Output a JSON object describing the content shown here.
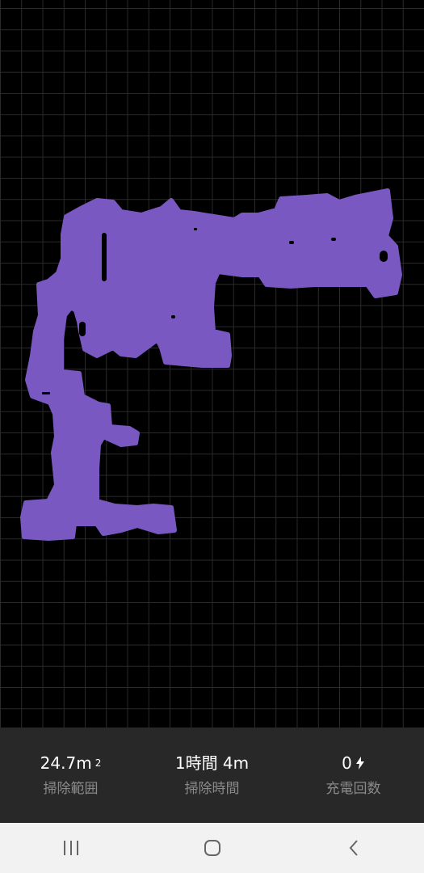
{
  "stats": {
    "area": {
      "value": "24.7m",
      "unit_sup": "2",
      "label": "掃除範囲"
    },
    "time": {
      "value": "1時間 4m",
      "label": "掃除時間"
    },
    "charge": {
      "value": "0",
      "label": "充電回数",
      "icon": "lightning-bolt-icon"
    }
  },
  "navigation": {
    "recent": "recent-apps-icon",
    "home": "home-icon",
    "back": "back-icon"
  },
  "colors": {
    "cleaned_area": "#7a58c2",
    "grid": "#2a2a2a",
    "stats_bg": "#282828",
    "nav_bg": "#f2f2f2"
  }
}
